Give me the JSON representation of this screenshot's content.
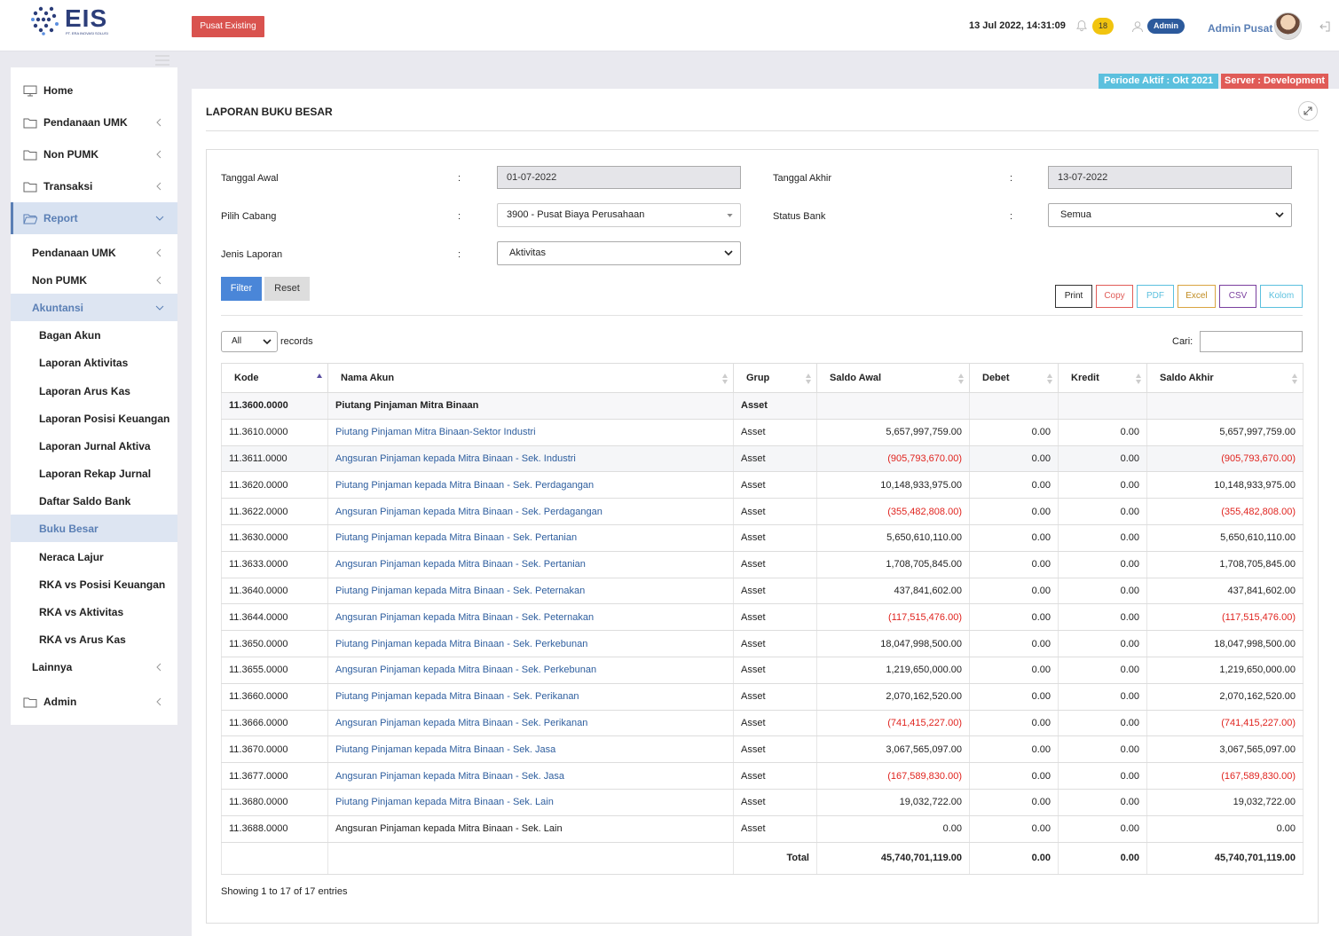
{
  "header": {
    "logo_text": "EIS",
    "logo_sub": "PT. ERA INOVASI SOLUSI",
    "mode_button": "Pusat Existing",
    "datetime": "13 Jul 2022, 14:31:09",
    "notifications": "18",
    "role_badge": "Admin",
    "username": "Admin Pusat"
  },
  "sidebar": {
    "home": "Home",
    "pendanaan_umk": "Pendanaan UMK",
    "non_pumk": "Non PUMK",
    "transaksi": "Transaksi",
    "report": "Report",
    "report_sub": {
      "pendanaan_umk": "Pendanaan UMK",
      "non_pumk": "Non PUMK",
      "akuntansi": "Akuntansi",
      "lainnya": "Lainnya"
    },
    "akuntansi_items": [
      "Bagan Akun",
      "Laporan Aktivitas",
      "Laporan Arus Kas",
      "Laporan Posisi Keuangan",
      "Laporan Jurnal Aktiva",
      "Laporan Rekap Jurnal",
      "Daftar Saldo Bank",
      "Buku Besar",
      "Neraca Lajur",
      "RKA vs Posisi Keuangan",
      "RKA vs Aktivitas",
      "RKA vs Arus Kas"
    ],
    "admin": "Admin"
  },
  "status": {
    "periode": "Periode Aktif : Okt 2021",
    "server": "Server : Development"
  },
  "page": {
    "title": "LAPORAN BUKU BESAR"
  },
  "filters": {
    "tanggal_awal_label": "Tanggal Awal",
    "tanggal_awal": "01-07-2022",
    "tanggal_akhir_label": "Tanggal Akhir",
    "tanggal_akhir": "13-07-2022",
    "cabang_label": "Pilih Cabang",
    "cabang": "3900 - Pusat Biaya Perusahaan",
    "status_bank_label": "Status Bank",
    "status_bank": "Semua",
    "jenis_label": "Jenis Laporan",
    "jenis": "Aktivitas",
    "colon": ":",
    "filter_btn": "Filter",
    "reset_btn": "Reset"
  },
  "export": {
    "print": "Print",
    "copy": "Copy",
    "pdf": "PDF",
    "excel": "Excel",
    "csv": "CSV",
    "kolom": "Kolom"
  },
  "table_controls": {
    "length": "All",
    "records_label": "records",
    "search_label": "Cari:"
  },
  "table": {
    "headers": [
      "Kode",
      "Nama Akun",
      "Grup",
      "Saldo Awal",
      "Debet",
      "Kredit",
      "Saldo Akhir"
    ],
    "rows": [
      {
        "kode": "11.3600.0000",
        "nama": "Piutang Pinjaman Mitra Binaan",
        "grup": "Asset",
        "saldo_awal": "",
        "debet": "",
        "kredit": "",
        "saldo_akhir": "",
        "type": "parent"
      },
      {
        "kode": "11.3610.0000",
        "nama": "Piutang Pinjaman Mitra Binaan-Sektor Industri",
        "grup": "Asset",
        "saldo_awal": "5,657,997,759.00",
        "debet": "0.00",
        "kredit": "0.00",
        "saldo_akhir": "5,657,997,759.00",
        "type": "link"
      },
      {
        "kode": "11.3611.0000",
        "nama": "Angsuran Pinjaman kepada Mitra Binaan - Sek. Industri",
        "grup": "Asset",
        "saldo_awal": "(905,793,670.00)",
        "debet": "0.00",
        "kredit": "0.00",
        "saldo_akhir": "(905,793,670.00)",
        "type": "link"
      },
      {
        "kode": "11.3620.0000",
        "nama": "Piutang Pinjaman kepada Mitra Binaan - Sek. Perdagangan",
        "grup": "Asset",
        "saldo_awal": "10,148,933,975.00",
        "debet": "0.00",
        "kredit": "0.00",
        "saldo_akhir": "10,148,933,975.00",
        "type": "link"
      },
      {
        "kode": "11.3622.0000",
        "nama": "Angsuran Pinjaman kepada Mitra Binaan - Sek. Perdagangan",
        "grup": "Asset",
        "saldo_awal": "(355,482,808.00)",
        "debet": "0.00",
        "kredit": "0.00",
        "saldo_akhir": "(355,482,808.00)",
        "type": "link"
      },
      {
        "kode": "11.3630.0000",
        "nama": "Piutang Pinjaman kepada Mitra Binaan - Sek. Pertanian",
        "grup": "Asset",
        "saldo_awal": "5,650,610,110.00",
        "debet": "0.00",
        "kredit": "0.00",
        "saldo_akhir": "5,650,610,110.00",
        "type": "link"
      },
      {
        "kode": "11.3633.0000",
        "nama": "Angsuran Pinjaman kepada Mitra Binaan - Sek. Pertanian",
        "grup": "Asset",
        "saldo_awal": "1,708,705,845.00",
        "debet": "0.00",
        "kredit": "0.00",
        "saldo_akhir": "1,708,705,845.00",
        "type": "link"
      },
      {
        "kode": "11.3640.0000",
        "nama": "Piutang Pinjaman kepada Mitra Binaan - Sek. Peternakan",
        "grup": "Asset",
        "saldo_awal": "437,841,602.00",
        "debet": "0.00",
        "kredit": "0.00",
        "saldo_akhir": "437,841,602.00",
        "type": "link"
      },
      {
        "kode": "11.3644.0000",
        "nama": "Angsuran Pinjaman kepada Mitra Binaan - Sek. Peternakan",
        "grup": "Asset",
        "saldo_awal": "(117,515,476.00)",
        "debet": "0.00",
        "kredit": "0.00",
        "saldo_akhir": "(117,515,476.00)",
        "type": "link"
      },
      {
        "kode": "11.3650.0000",
        "nama": "Piutang Pinjaman kepada Mitra Binaan - Sek. Perkebunan",
        "grup": "Asset",
        "saldo_awal": "18,047,998,500.00",
        "debet": "0.00",
        "kredit": "0.00",
        "saldo_akhir": "18,047,998,500.00",
        "type": "link"
      },
      {
        "kode": "11.3655.0000",
        "nama": "Angsuran Pinjaman kepada Mitra Binaan - Sek. Perkebunan",
        "grup": "Asset",
        "saldo_awal": "1,219,650,000.00",
        "debet": "0.00",
        "kredit": "0.00",
        "saldo_akhir": "1,219,650,000.00",
        "type": "link"
      },
      {
        "kode": "11.3660.0000",
        "nama": "Piutang Pinjaman kepada Mitra Binaan - Sek. Perikanan",
        "grup": "Asset",
        "saldo_awal": "2,070,162,520.00",
        "debet": "0.00",
        "kredit": "0.00",
        "saldo_akhir": "2,070,162,520.00",
        "type": "link"
      },
      {
        "kode": "11.3666.0000",
        "nama": "Angsuran Pinjaman kepada Mitra Binaan - Sek. Perikanan",
        "grup": "Asset",
        "saldo_awal": "(741,415,227.00)",
        "debet": "0.00",
        "kredit": "0.00",
        "saldo_akhir": "(741,415,227.00)",
        "type": "link"
      },
      {
        "kode": "11.3670.0000",
        "nama": "Piutang Pinjaman kepada Mitra Binaan - Sek. Jasa",
        "grup": "Asset",
        "saldo_awal": "3,067,565,097.00",
        "debet": "0.00",
        "kredit": "0.00",
        "saldo_akhir": "3,067,565,097.00",
        "type": "link"
      },
      {
        "kode": "11.3677.0000",
        "nama": "Angsuran Pinjaman kepada Mitra Binaan - Sek. Jasa",
        "grup": "Asset",
        "saldo_awal": "(167,589,830.00)",
        "debet": "0.00",
        "kredit": "0.00",
        "saldo_akhir": "(167,589,830.00)",
        "type": "link"
      },
      {
        "kode": "11.3680.0000",
        "nama": "Piutang Pinjaman kepada Mitra Binaan - Sek. Lain",
        "grup": "Asset",
        "saldo_awal": "19,032,722.00",
        "debet": "0.00",
        "kredit": "0.00",
        "saldo_akhir": "19,032,722.00",
        "type": "link"
      },
      {
        "kode": "11.3688.0000",
        "nama": "Angsuran Pinjaman kepada Mitra Binaan - Sek. Lain",
        "grup": "Asset",
        "saldo_awal": "0.00",
        "debet": "0.00",
        "kredit": "0.00",
        "saldo_akhir": "0.00",
        "type": "plain"
      }
    ],
    "total": {
      "label": "Total",
      "saldo_awal": "45,740,701,119.00",
      "debet": "0.00",
      "kredit": "0.00",
      "saldo_akhir": "45,740,701,119.00"
    }
  },
  "footer": {
    "showing": "Showing 1 to 17 of 17 entries"
  },
  "colors": {
    "accent": "#5a7fb5",
    "danger": "#d9534f",
    "info": "#5bc0de",
    "negative": "#e0241f",
    "link": "#2e5e9e"
  }
}
